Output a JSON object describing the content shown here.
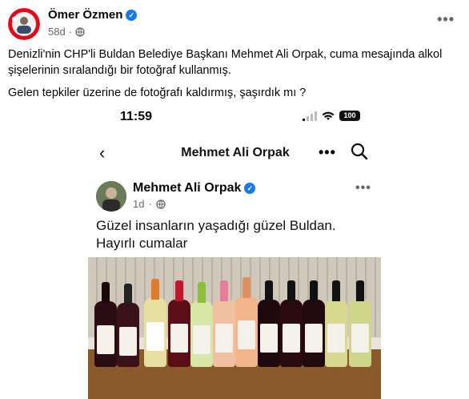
{
  "post": {
    "author": "Ömer Özmen",
    "time": "58d",
    "text_1": "Denizli'nin CHP'li Buldan Belediye Başkanı Mehmet Ali Orpak, cuma mesajında alkol şişelerinin sıralandığı bir fotoğraf kullanmış.",
    "text_2": "Gelen tepkiler üzerine de fotoğrafı kaldırmış, şaşırdık mı ?"
  },
  "screenshot": {
    "status_time": "11:59",
    "battery": "100",
    "nav_title": "Mehmet Ali Orpak",
    "inner_author": "Mehmet Ali Orpak",
    "inner_time": "1d",
    "inner_text_1": "Güzel  insanların yaşadığı güzel Buldan.",
    "inner_text_2": "Hayırlı cumalar"
  },
  "colors": {
    "accent": "#1877f2",
    "meta_gray": "#65676b"
  },
  "icons": [
    "verified-icon",
    "globe-icon",
    "more-icon",
    "back-icon",
    "search-icon",
    "signal-icon",
    "wifi-icon",
    "battery-icon"
  ]
}
